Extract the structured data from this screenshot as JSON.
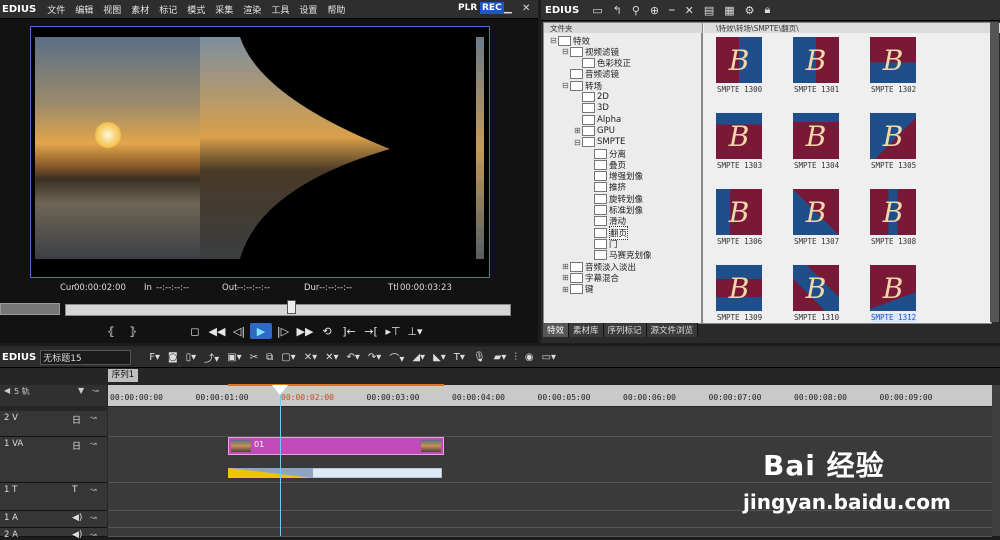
{
  "player": {
    "app_logo": "EDIUS",
    "menu": [
      "文件",
      "编辑",
      "视图",
      "素材",
      "标记",
      "模式",
      "采集",
      "渲染",
      "工具",
      "设置",
      "帮助"
    ],
    "plr": "PLR",
    "rec": "REC",
    "timecodes": {
      "cur_label": "Cur",
      "cur": "00:00:02:00",
      "in_label": "In",
      "in": "--:--:--:--",
      "out_label": "Out",
      "out": "--:--:--:--",
      "dur_label": "Dur",
      "dur": "--:--:--:--",
      "ttl_label": "Ttl",
      "ttl": "00:00:03:23"
    }
  },
  "bin": {
    "app_logo": "EDIUS",
    "folder_header": "文件夹",
    "tree": [
      {
        "label": "特效",
        "toggle": "⊟"
      },
      {
        "label": "视频滤镜",
        "toggle": "⊟"
      },
      {
        "label": "色彩校正",
        "toggle": ""
      },
      {
        "label": "音频滤镜",
        "toggle": ""
      },
      {
        "label": "转场",
        "toggle": "⊟"
      },
      {
        "label": "2D",
        "toggle": ""
      },
      {
        "label": "3D",
        "toggle": ""
      },
      {
        "label": "Alpha",
        "toggle": ""
      },
      {
        "label": "GPU",
        "toggle": "⊞"
      },
      {
        "label": "SMPTE",
        "toggle": "⊟"
      },
      {
        "label": "分离",
        "toggle": ""
      },
      {
        "label": "叠页",
        "toggle": ""
      },
      {
        "label": "增强划像",
        "toggle": ""
      },
      {
        "label": "推挤",
        "toggle": ""
      },
      {
        "label": "旋转划像",
        "toggle": ""
      },
      {
        "label": "标准划像",
        "toggle": ""
      },
      {
        "label": "滑动",
        "toggle": ""
      },
      {
        "label": "翻页",
        "toggle": ""
      },
      {
        "label": "门",
        "toggle": ""
      },
      {
        "label": "马赛克划像",
        "toggle": ""
      },
      {
        "label": "音频淡入淡出",
        "toggle": "⊞"
      },
      {
        "label": "字幕混合",
        "toggle": "⊞"
      },
      {
        "label": "键",
        "toggle": "⊞"
      }
    ],
    "clip_path": "\\特效\\转场\\SMPTE\\翻页\\",
    "clips": [
      "SMPTE 1300",
      "SMPTE 1301",
      "SMPTE 1302",
      "SMPTE 1303",
      "SMPTE 1304",
      "SMPTE 1305",
      "SMPTE 1306",
      "SMPTE 1307",
      "SMPTE 1308",
      "SMPTE 1309",
      "SMPTE 1310",
      "SMPTE 1312"
    ],
    "thumb_letter": "B",
    "tabs": [
      "特效",
      "素材库",
      "序列标记",
      "源文件浏览"
    ]
  },
  "timeline": {
    "app_logo": "EDIUS",
    "project_title": "无标题15",
    "sequence_tab": "序列1",
    "track_count_label": "5 轨",
    "ruler": [
      "00:00:00:00",
      "00:00:01:00",
      "00:00:02:00",
      "00:00:03:00",
      "00:00:04:00",
      "00:00:05:00",
      "00:00:06:00",
      "00:00:07:00",
      "00:00:08:00",
      "00:00:09:00"
    ],
    "tracks": [
      {
        "name": "2 V",
        "icon": "日"
      },
      {
        "name": "1 VA",
        "icon": "日"
      },
      {
        "name": "1 T",
        "icon": "T"
      },
      {
        "name": "1 A",
        "icon": "◀)"
      },
      {
        "name": "2 A",
        "icon": "◀)"
      }
    ],
    "clip_label": "01"
  },
  "watermark": {
    "main": "Bai  经验",
    "sub": "jingyan.baidu.com"
  }
}
